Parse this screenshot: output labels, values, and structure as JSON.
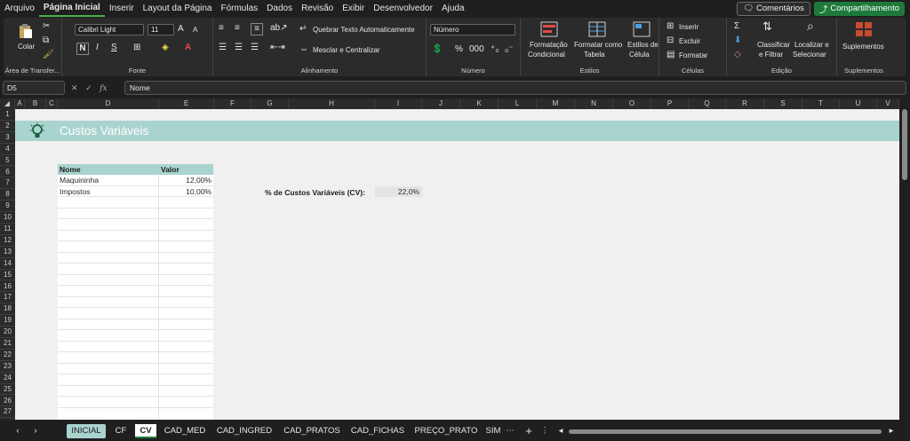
{
  "menu": {
    "items": [
      "Arquivo",
      "Página Inicial",
      "Inserir",
      "Layout da Página",
      "Fórmulas",
      "Dados",
      "Revisão",
      "Exibir",
      "Desenvolvedor",
      "Ajuda"
    ],
    "comments_label": "Comentários",
    "share_label": "Compartilhamento"
  },
  "ribbon": {
    "clipboard": {
      "paste_label": "Colar",
      "group_label": "Área de Transfer..."
    },
    "font": {
      "name": "Calibri Light",
      "size": "11",
      "group_label": "Fonte",
      "bold": "N",
      "italic": "I",
      "underline": "S"
    },
    "alignment": {
      "wrap_label": "Quebrar Texto Automaticamente",
      "merge_label": "Mesclar e Centralizar",
      "group_label": "Alinhamento"
    },
    "number": {
      "format": "Número",
      "group_label": "Número"
    },
    "styles": {
      "cond_format_1": "Formatação",
      "cond_format_2": "Condicional",
      "table_1": "Formatar como",
      "table_2": "Tabela",
      "cell_styles_1": "Estilos de",
      "cell_styles_2": "Célula",
      "group_label": "Estilos"
    },
    "cells": {
      "insert_label": "Inserir",
      "delete_label": "Excluir",
      "format_label": "Formatar",
      "group_label": "Células"
    },
    "editing": {
      "sort_1": "Classificar",
      "sort_2": "e Filtrar",
      "find_1": "Localizar e",
      "find_2": "Selecionar",
      "group_label": "Edição"
    },
    "addins": {
      "label": "Suplementos",
      "group_label": "Suplementos"
    }
  },
  "formula_bar": {
    "cell_ref": "D5",
    "fx": "fx",
    "content": "Nome"
  },
  "columns": [
    "A",
    "B",
    "C",
    "D",
    "E",
    "F",
    "G",
    "H",
    "I",
    "J",
    "K",
    "L",
    "M",
    "N",
    "O",
    "P",
    "Q",
    "R",
    "S",
    "T",
    "U",
    "V"
  ],
  "rows": [
    "1",
    "2",
    "3",
    "4",
    "5",
    "6",
    "7",
    "8",
    "9",
    "10",
    "11",
    "12",
    "13",
    "14",
    "15",
    "16",
    "17",
    "18",
    "19",
    "20",
    "21",
    "22",
    "23",
    "24",
    "25",
    "26",
    "27"
  ],
  "sheet": {
    "title": "Custos Variáveis",
    "table": {
      "headers": [
        "Nome",
        "Valor"
      ],
      "rows": [
        [
          "Maquininha",
          "12,00%"
        ],
        [
          "Impostos",
          "10,00%"
        ]
      ]
    },
    "cv_label": "% de Custos Variáveis (CV):",
    "cv_value": "22,0%"
  },
  "tabs": [
    "INICIAL",
    "CF",
    "CV",
    "CAD_MED",
    "CAD_INGRED",
    "CAD_PRATOS",
    "CAD_FICHAS",
    "PREÇO_PRATO",
    "SIM"
  ],
  "active_tab": "CV",
  "colors": {
    "accent": "#a9d3cf",
    "share_green": "#1d7a3a",
    "dark_bg": "#1f1f1f"
  }
}
